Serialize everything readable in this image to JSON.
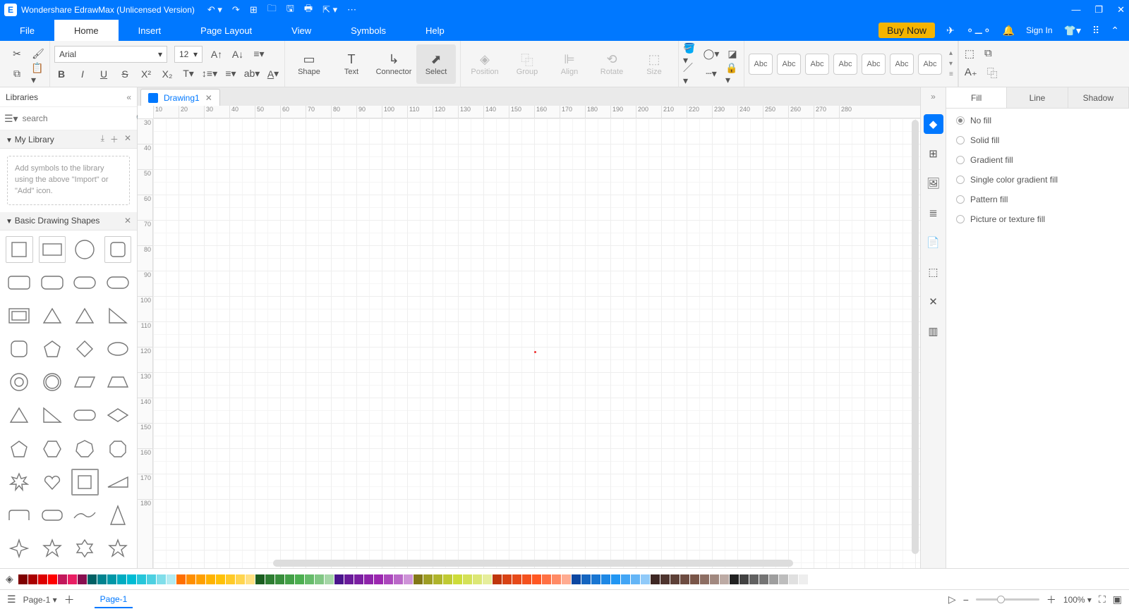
{
  "app_title": "Wondershare EdrawMax (Unlicensed Version)",
  "menus": [
    "File",
    "Home",
    "Insert",
    "Page Layout",
    "View",
    "Symbols",
    "Help"
  ],
  "active_menu": "Home",
  "buy_label": "Buy Now",
  "signin_label": "Sign In",
  "ribbon": {
    "font_name": "Arial",
    "font_size": "12",
    "bigtools": {
      "shape": "Shape",
      "text": "Text",
      "connector": "Connector",
      "select": "Select",
      "position": "Position",
      "group": "Group",
      "align": "Align",
      "rotate": "Rotate",
      "size": "Size"
    },
    "style_label": "Abc"
  },
  "libraries": {
    "title": "Libraries",
    "search_placeholder": "search",
    "mylib_title": "My Library",
    "mylib_placeholder": "Add symbols to the library using the above \"Import\" or \"Add\" icon.",
    "shapes_title": "Basic Drawing Shapes"
  },
  "doc_tab": "Drawing1",
  "ruler_h": [
    "10",
    "20",
    "30",
    "40",
    "50",
    "60",
    "70",
    "80",
    "90",
    "100",
    "110",
    "120",
    "130",
    "140",
    "150",
    "160",
    "170",
    "180",
    "190",
    "200",
    "210",
    "220",
    "230",
    "240",
    "250",
    "260",
    "270",
    "280"
  ],
  "ruler_v": [
    "30",
    "40",
    "50",
    "60",
    "70",
    "80",
    "90",
    "100",
    "110",
    "120",
    "130",
    "140",
    "150",
    "160",
    "170",
    "180"
  ],
  "right_tabs": [
    "Fill",
    "Line",
    "Shadow"
  ],
  "active_right_tab": "Fill",
  "fill_options": [
    "No fill",
    "Solid fill",
    "Gradient fill",
    "Single color gradient fill",
    "Pattern fill",
    "Picture or texture fill"
  ],
  "selected_fill": "No fill",
  "color_swatches": [
    "#7f0000",
    "#a00",
    "#d00",
    "#f00",
    "#c2185b",
    "#e91e63",
    "#880e4f",
    "#006064",
    "#00838f",
    "#0097a7",
    "#00acc1",
    "#00bcd4",
    "#26c6da",
    "#4dd0e1",
    "#80deea",
    "#b2ebf2",
    "#ff6f00",
    "#ff8f00",
    "#ffa000",
    "#ffb300",
    "#ffc107",
    "#ffca28",
    "#ffd54f",
    "#ffe082",
    "#1b5e20",
    "#2e7d32",
    "#388e3c",
    "#43a047",
    "#4caf50",
    "#66bb6a",
    "#81c784",
    "#a5d6a7",
    "#4a148c",
    "#6a1b9a",
    "#7b1fa2",
    "#8e24aa",
    "#9c27b0",
    "#ab47bc",
    "#ba68c8",
    "#ce93d8",
    "#827717",
    "#9e9d24",
    "#afb42b",
    "#c0ca33",
    "#cddc39",
    "#d4e157",
    "#dce775",
    "#e6ee9c",
    "#bf360c",
    "#d84315",
    "#e64a19",
    "#f4511e",
    "#ff5722",
    "#ff7043",
    "#ff8a65",
    "#ffab91",
    "#0d47a1",
    "#1565c0",
    "#1976d2",
    "#1e88e5",
    "#2196f3",
    "#42a5f5",
    "#64b5f6",
    "#90caf9",
    "#3e2723",
    "#4e342e",
    "#5d4037",
    "#6d4c41",
    "#795548",
    "#8d6e63",
    "#a1887f",
    "#bcaaa4",
    "#212121",
    "#424242",
    "#616161",
    "#757575",
    "#9e9e9e",
    "#bdbdbd",
    "#e0e0e0",
    "#eeeeee"
  ],
  "page_selector": "Page-1",
  "page_tab": "Page-1",
  "zoom_label": "100%"
}
